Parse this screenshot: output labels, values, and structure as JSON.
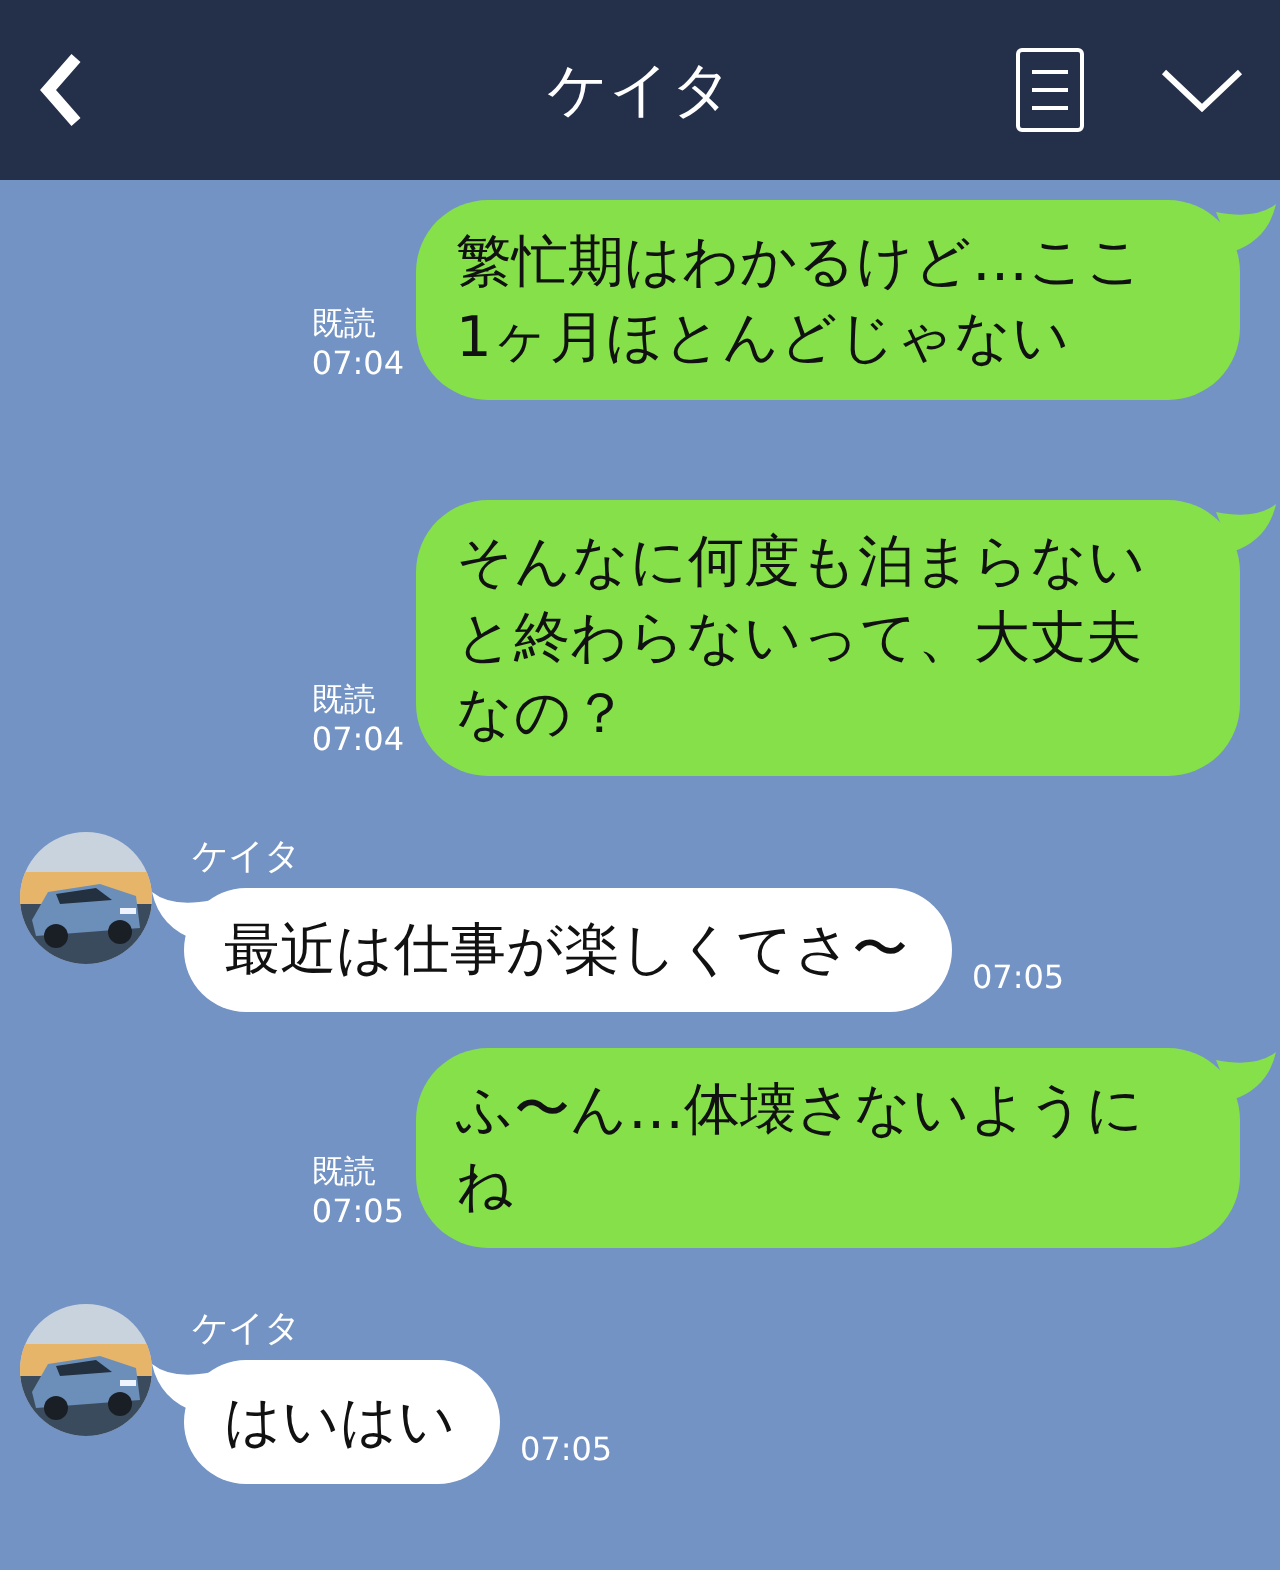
{
  "header": {
    "title": "ケイタ"
  },
  "messages": [
    {
      "kind": "sent",
      "lines": [
        "繁忙期はわかるけど…ここ",
        "1ヶ月ほとんどじゃない"
      ],
      "read": "既読",
      "time": "07:04"
    },
    {
      "kind": "sent",
      "lines": [
        "そんなに何度も泊まらない",
        "と終わらないって、大丈夫",
        "なの？"
      ],
      "read": "既読",
      "time": "07:04"
    },
    {
      "kind": "received",
      "sender": "ケイタ",
      "lines": [
        "最近は仕事が楽しくてさ〜"
      ],
      "time": "07:05"
    },
    {
      "kind": "sent",
      "lines": [
        "ふ〜ん…体壊さないように",
        "ね"
      ],
      "read": "既読",
      "time": "07:05"
    },
    {
      "kind": "received",
      "sender": "ケイタ",
      "lines": [
        "はいはい"
      ],
      "time": "07:05"
    }
  ]
}
